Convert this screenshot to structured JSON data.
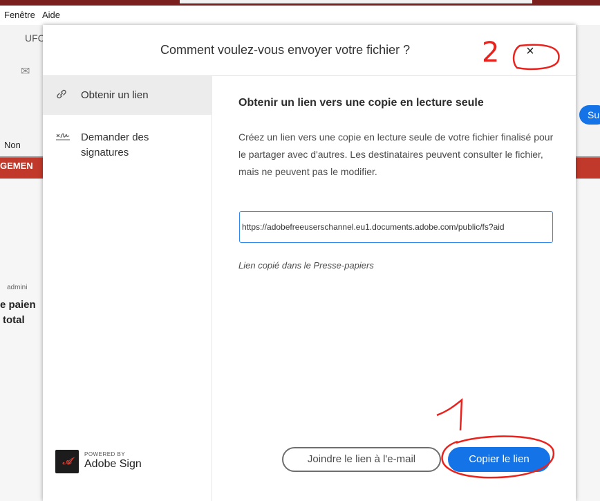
{
  "menubar": {
    "items": [
      "Fenêtre",
      "Aide"
    ]
  },
  "background": {
    "fragments": [
      "UFC",
      "Su",
      "Non",
      "GEMEN",
      "e paien",
      "total",
      "admini"
    ]
  },
  "dialog": {
    "title": "Comment voulez-vous envoyer votre fichier ?",
    "close_glyph": "×",
    "sidebar": {
      "items": [
        {
          "label": "Obtenir un lien",
          "icon": "link-icon",
          "glyph": "🔗",
          "active": true
        },
        {
          "label": "Demander des signatures",
          "icon": "signature-icon",
          "glyph": "✍",
          "active": false
        }
      ],
      "powered_by": "POWERED BY",
      "brand": "Adobe Sign",
      "logo_icon": "adobe-sign-logo"
    },
    "content": {
      "heading": "Obtenir un lien vers une copie en lecture seule",
      "description": "Créez un lien vers une copie en lecture seule de votre fichier finalisé pour le partager avec d'autres. Les destinataires peuvent consulter le fichier, mais ne peuvent pas le modifier.",
      "link_value": "https://adobefreeuserschannel.eu1.documents.adobe.com/public/fs?aid",
      "copied_message": "Lien copié dans le Presse-papiers",
      "attach_button": "Joindre le lien à l'e-mail",
      "copy_button": "Copier le lien"
    }
  },
  "annotations": {
    "number_1": "1",
    "number_2": "2",
    "color": "#e8231e"
  },
  "colors": {
    "primary": "#1473e6",
    "header_bg": "#7b1e1e"
  }
}
